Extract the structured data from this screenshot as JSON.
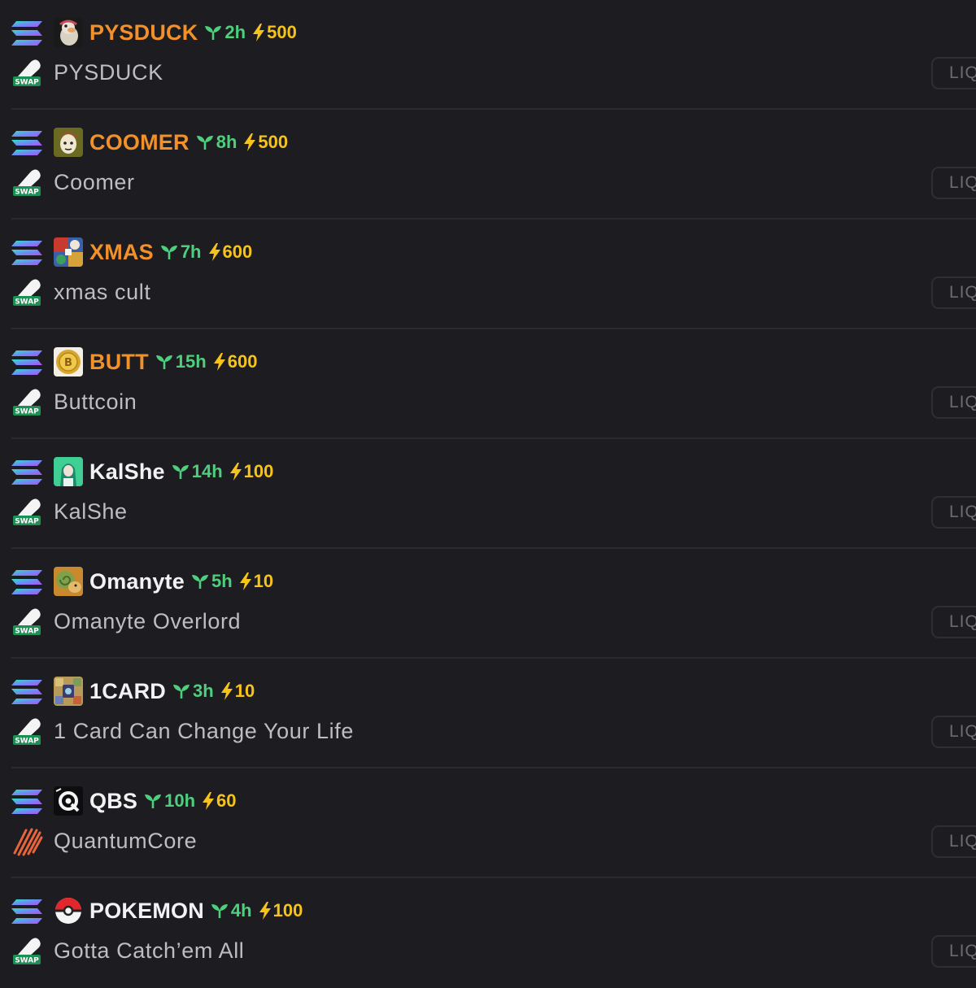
{
  "colors": {
    "background": "#1d1d21",
    "ticker_orange": "#f2902a",
    "ticker_white": "#f2f2f4",
    "age_green": "#4ecf7d",
    "power_yellow": "#f6c31a",
    "name_gray": "#bdbdc2",
    "liq_gray": "#6b6b72"
  },
  "liq_label": "LIQ",
  "tokens": [
    {
      "ticker": "PYSDUCK",
      "ticker_color": "#f2902a",
      "age": "2h",
      "power": "500",
      "name": "PYSDUCK",
      "thumb_icon": "duck-avatar-icon",
      "dex_icon": "swap-icon"
    },
    {
      "ticker": "COOMER",
      "ticker_color": "#f2902a",
      "age": "8h",
      "power": "500",
      "name": "Coomer",
      "thumb_icon": "coomer-avatar-icon",
      "dex_icon": "swap-icon"
    },
    {
      "ticker": "XMAS",
      "ticker_color": "#f2902a",
      "age": "7h",
      "power": "600",
      "name": "xmas cult",
      "thumb_icon": "xmas-avatar-icon",
      "dex_icon": "swap-icon"
    },
    {
      "ticker": "BUTT",
      "ticker_color": "#f2902a",
      "age": "15h",
      "power": "600",
      "name": "Buttcoin",
      "thumb_icon": "coin-avatar-icon",
      "dex_icon": "swap-icon"
    },
    {
      "ticker": "KalShe",
      "ticker_color": "#f2f2f4",
      "age": "14h",
      "power": "100",
      "name": "KalShe",
      "thumb_icon": "anime-avatar-icon",
      "dex_icon": "swap-icon"
    },
    {
      "ticker": "Omanyte",
      "ticker_color": "#f2f2f4",
      "age": "5h",
      "power": "10",
      "name": "Omanyte Overlord",
      "thumb_icon": "omanyte-avatar-icon",
      "dex_icon": "swap-icon"
    },
    {
      "ticker": "1CARD",
      "ticker_color": "#f2f2f4",
      "age": "3h",
      "power": "10",
      "name": "1 Card Can Change Your Life",
      "thumb_icon": "card-avatar-icon",
      "dex_icon": "swap-icon"
    },
    {
      "ticker": "QBS",
      "ticker_color": "#f2f2f4",
      "age": "10h",
      "power": "60",
      "name": "QuantumCore",
      "thumb_icon": "qbs-avatar-icon",
      "dex_icon": "stripes-icon"
    },
    {
      "ticker": "POKEMON",
      "ticker_color": "#f2f2f4",
      "age": "4h",
      "power": "100",
      "name": "Gotta Catch’em All",
      "thumb_icon": "pokeball-avatar-icon",
      "dex_icon": "swap-icon"
    }
  ]
}
